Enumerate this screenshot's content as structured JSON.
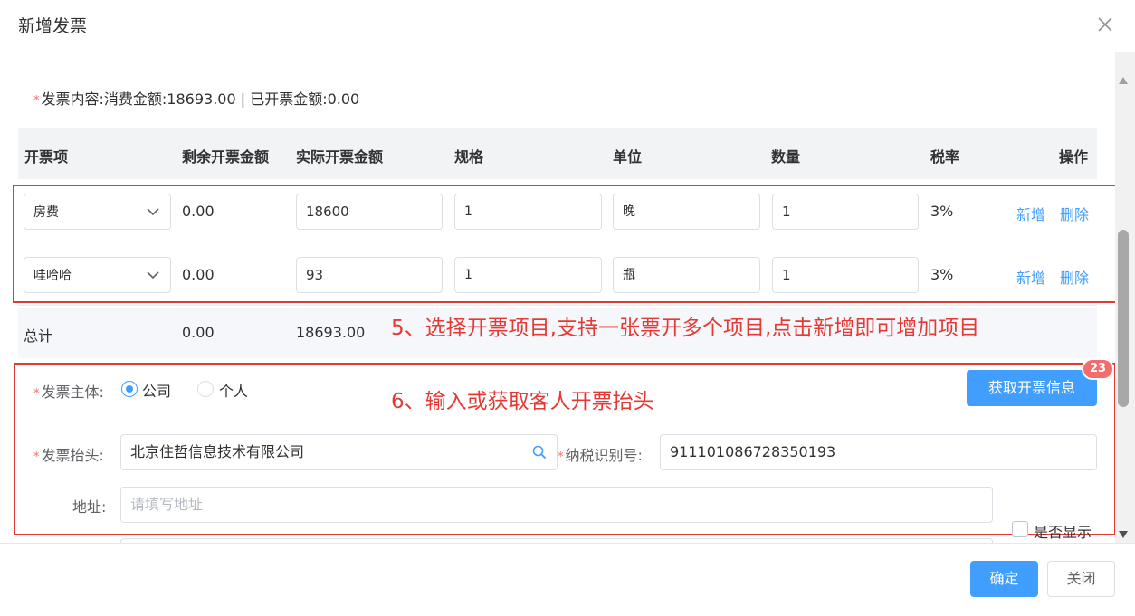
{
  "dialog": {
    "title": "新增发票"
  },
  "content_line": {
    "label": "发票内容:",
    "text": "消费金额:18693.00 | 已开票金额:0.00"
  },
  "table": {
    "headers": [
      "开票项",
      "剩余开票金额",
      "实际开票金额",
      "规格",
      "单位",
      "数量",
      "税率",
      "操作"
    ],
    "rows": [
      {
        "item": "房费",
        "remaining": "0.00",
        "actual": "18600",
        "spec": "1",
        "unit": "晚",
        "qty": "1",
        "tax": "3%",
        "add": "新增",
        "delete": "删除"
      },
      {
        "item": "哇哈哈",
        "remaining": "0.00",
        "actual": "93",
        "spec": "1",
        "unit": "瓶",
        "qty": "1",
        "tax": "3%",
        "add": "新增",
        "delete": "删除"
      }
    ],
    "total": {
      "label": "总计",
      "remaining": "0.00",
      "actual": "18693.00"
    }
  },
  "annotations": {
    "step5": "5、选择开票项目,支持一张票开多个项目,点击新增即可增加项目",
    "step6": "6、输入或获取客人开票抬头"
  },
  "form": {
    "subject_label": "发票主体:",
    "subject_options": [
      "公司",
      "个人"
    ],
    "subject_selected": "公司",
    "fetch_button": "获取开票信息",
    "badge_count": "23",
    "title_label": "发票抬头:",
    "title_value": "北京住哲信息技术有限公司",
    "taxid_label": "纳税识别号:",
    "taxid_value": "911101086728350193",
    "address_label": "地址:",
    "address_placeholder": "请填写地址",
    "show_checkbox_label": "是否显示"
  },
  "footer": {
    "confirm": "确定",
    "close": "关闭"
  },
  "colors": {
    "primary": "#409eff",
    "required": "#f56c6c",
    "annotation": "#e53935",
    "badge": "#f56c6c"
  }
}
